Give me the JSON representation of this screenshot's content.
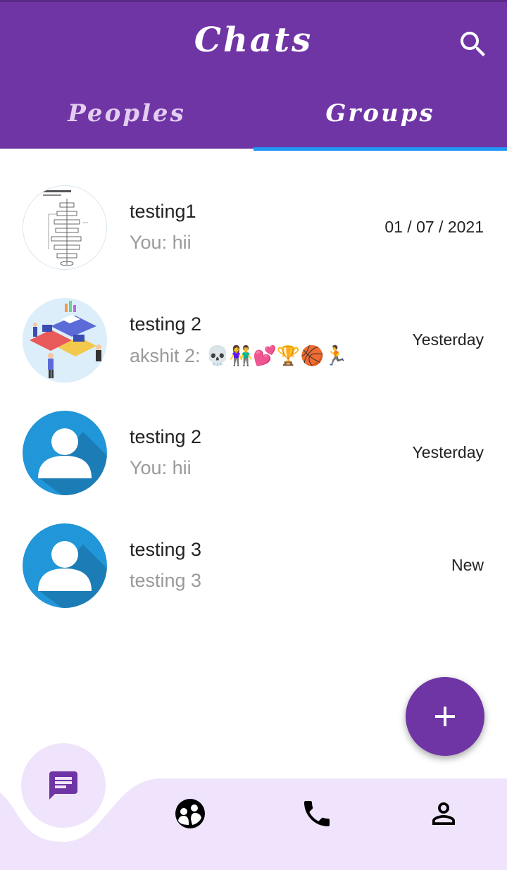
{
  "header": {
    "title": "Chats",
    "tabs": [
      {
        "label": "Peoples",
        "selected": false
      },
      {
        "label": "Groups",
        "selected": true
      }
    ]
  },
  "chats": [
    {
      "name": "testing1",
      "last_message": "You: hii",
      "date": "01 / 07 / 2021",
      "avatar": "flowchart-image"
    },
    {
      "name": "testing 2",
      "last_message": "akshit 2: 💀👫💕🏆🏀🏃",
      "date": "Yesterday",
      "avatar": "office-illustration-image"
    },
    {
      "name": "testing 2",
      "last_message": "You: hii",
      "date": "Yesterday",
      "avatar": "default-user-avatar"
    },
    {
      "name": "testing 3",
      "last_message": "testing 3",
      "date": "New",
      "avatar": "default-user-avatar"
    }
  ],
  "fab": {
    "icon": "plus-icon"
  },
  "bottom_nav": [
    {
      "icon": "chat-icon",
      "selected": true
    },
    {
      "icon": "groups-icon",
      "selected": false
    },
    {
      "icon": "phone-icon",
      "selected": false
    },
    {
      "icon": "person-icon",
      "selected": false
    }
  ],
  "colors": {
    "primary": "#6f35a5",
    "indicator": "#2196f3",
    "nav_background": "#efe4fb",
    "avatar_blue": "#2196d8"
  }
}
